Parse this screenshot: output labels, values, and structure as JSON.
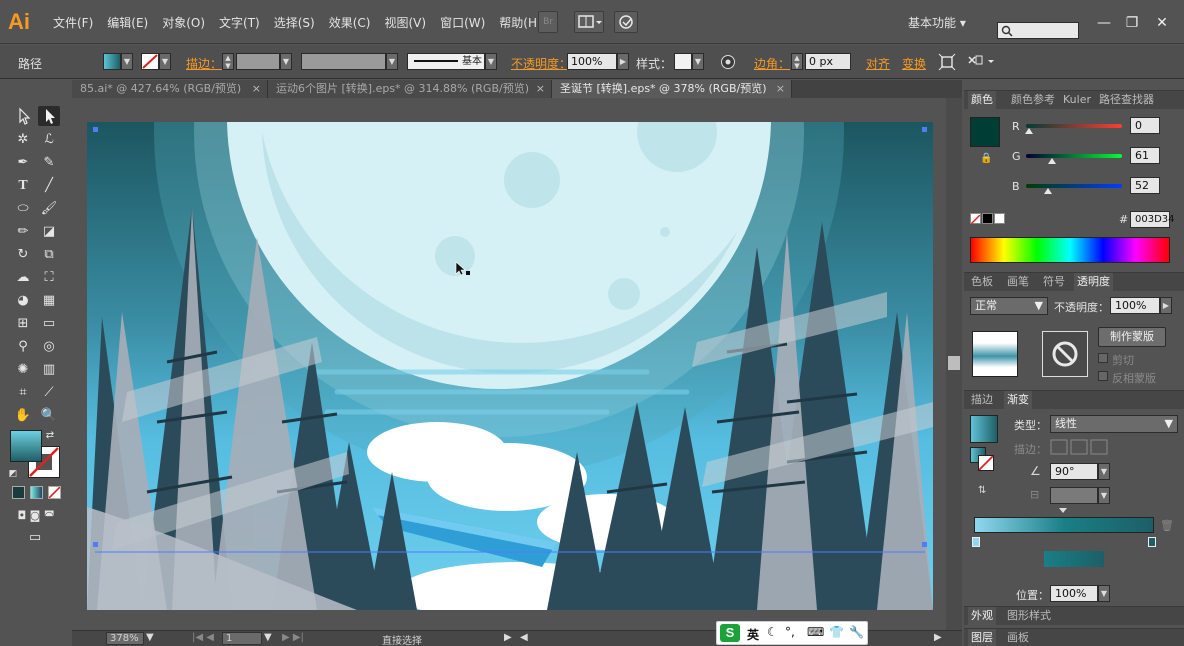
{
  "app": {
    "logo": "Ai",
    "workspace": "基本功能",
    "workspace_arrow": "▾"
  },
  "menu": [
    "文件(F)",
    "编辑(E)",
    "对象(O)",
    "文字(T)",
    "选择(S)",
    "效果(C)",
    "视图(V)",
    "窗口(W)",
    "帮助(H)"
  ],
  "menubar_icons": {
    "bridge": "Br"
  },
  "window_controls": {
    "minimize": "—",
    "restore": "❐",
    "close": "✕"
  },
  "control_bar": {
    "selection": "路径",
    "stroke_label": "描边：",
    "stroke_profile": "基本",
    "opacity_label": "不透明度：",
    "opacity_value": "100%",
    "style_label": "样式：",
    "corner_label": "边角：",
    "corner_value": "0 px",
    "align_label": "对齐",
    "transform_label": "变换"
  },
  "tabs": [
    {
      "label": "85.ai* @ 427.64% (RGB/预览)",
      "active": false
    },
    {
      "label": "运动6个图片 [转换].eps* @ 314.88% (RGB/预览)",
      "active": false
    },
    {
      "label": "圣诞节 [转换].eps* @ 378% (RGB/预览)",
      "active": true
    }
  ],
  "tab_close": "×",
  "color_panel": {
    "tabs": [
      "颜色",
      "颜色参考",
      "Kuler",
      "路径查找器"
    ],
    "r_label": "R",
    "r_value": "0",
    "g_label": "G",
    "g_value": "61",
    "b_label": "B",
    "b_value": "52",
    "hash": "#",
    "hex_value": "003D34",
    "fill_color": "#003D34"
  },
  "transparency_panel": {
    "tabs": [
      "色板",
      "画笔",
      "符号",
      "透明度"
    ],
    "blend_mode": "正常",
    "opacity_label": "不透明度：",
    "opacity_value": "100%",
    "make_mask": "制作蒙版",
    "clip": "剪切",
    "invert": "反相蒙版"
  },
  "gradient_panel": {
    "tabs": [
      "描边",
      "渐变"
    ],
    "type_label": "类型：",
    "type_value": "线性",
    "stroke_label": "描边：",
    "angle_value": "90°",
    "location_label": "位置：",
    "location_value": "100%"
  },
  "appearance_panel": {
    "tabs": [
      "外观",
      "图形样式"
    ]
  },
  "layers_panel": {
    "tabs": [
      "图层",
      "画板"
    ]
  },
  "status_bar": {
    "zoom": "378%",
    "page": "1",
    "tool": "直接选择"
  },
  "ime": {
    "brand": "S",
    "lang": "英"
  },
  "colors": {
    "sky_top": "#1d5b62",
    "sky_mid": "#4db7d8",
    "moon": "#d6f1f5",
    "tree_dark": "#2c4b5a",
    "tree_light": "#a6aeb8",
    "accent": "#f59a23"
  }
}
